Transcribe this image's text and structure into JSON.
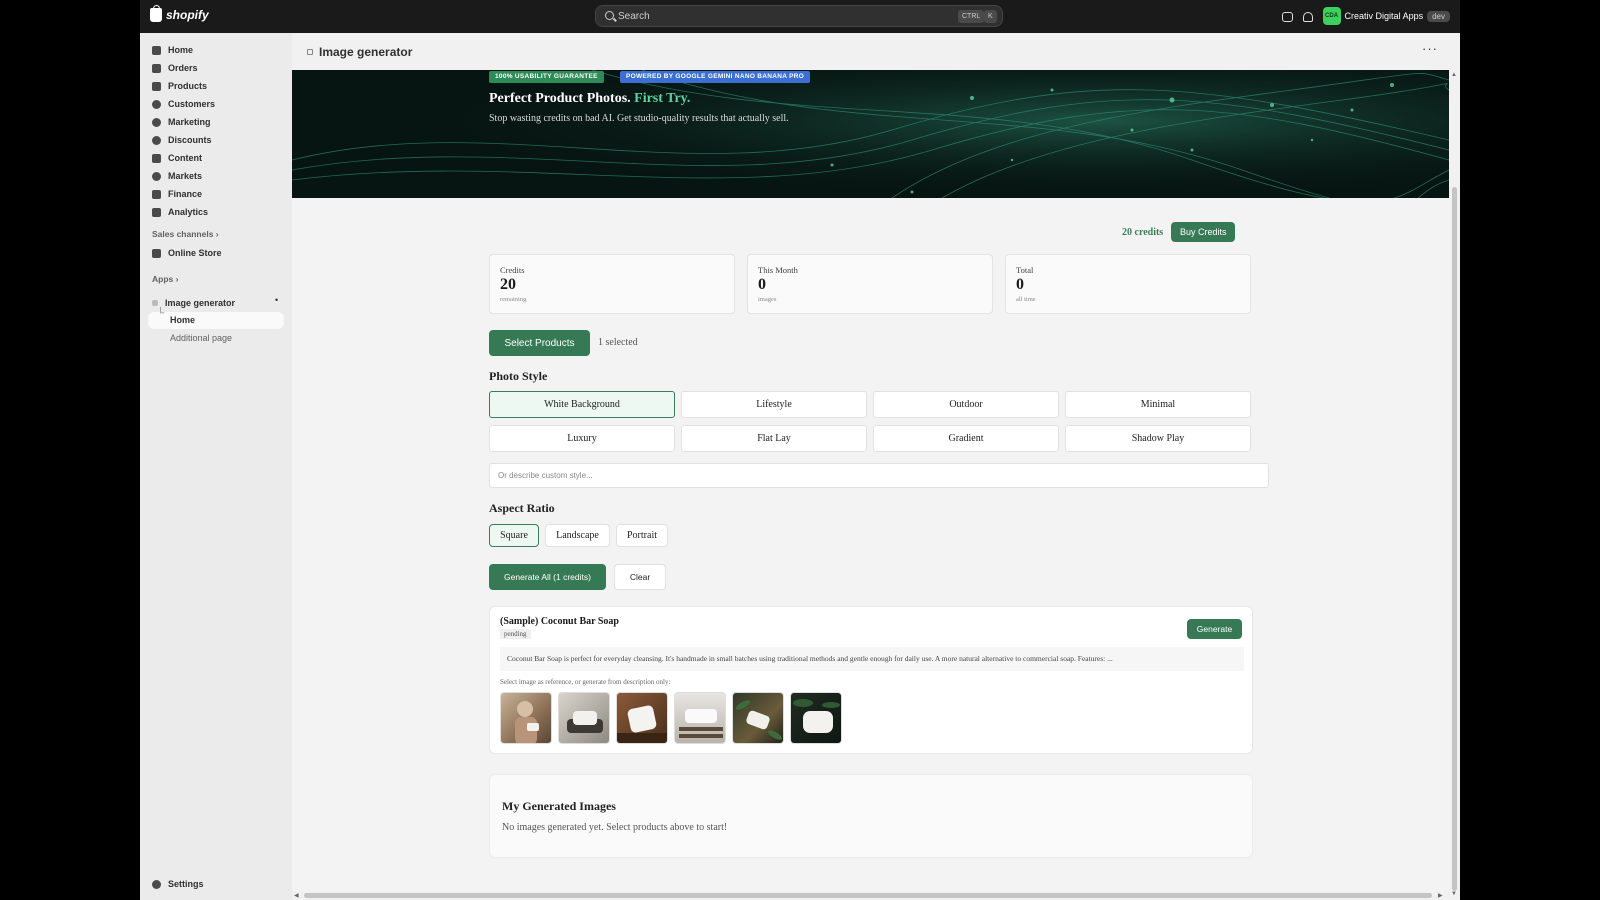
{
  "topbar": {
    "logo_text": "shopify",
    "search_placeholder": "Search",
    "shortcut_keys": [
      "CTRL",
      "K"
    ],
    "avatar_initials": "CDA",
    "store_name": "Creativ Digital Apps",
    "env_badge": "dev"
  },
  "sidebar": {
    "items": [
      {
        "label": "Home",
        "icon": "home-icon"
      },
      {
        "label": "Orders",
        "icon": "orders-icon"
      },
      {
        "label": "Products",
        "icon": "tag-icon"
      },
      {
        "label": "Customers",
        "icon": "person-icon"
      },
      {
        "label": "Marketing",
        "icon": "target-icon"
      },
      {
        "label": "Discounts",
        "icon": "discount-icon"
      },
      {
        "label": "Content",
        "icon": "content-icon"
      },
      {
        "label": "Markets",
        "icon": "globe-icon"
      },
      {
        "label": "Finance",
        "icon": "bank-icon"
      },
      {
        "label": "Analytics",
        "icon": "bar-chart-icon"
      }
    ],
    "sales_channels_label": "Sales channels",
    "online_store": "Online Store",
    "apps_label": "Apps",
    "app_name": "Image generator",
    "app_home": "Home",
    "app_additional": "Additional page",
    "settings": "Settings"
  },
  "page": {
    "title": "Image generator",
    "more": "···"
  },
  "hero": {
    "badge1": "100% USABILITY GUARANTEE",
    "badge2": "POWERED BY GOOGLE GEMINI NANO BANANA PRO",
    "title_main": "Perfect Product Photos.",
    "title_highlight": "First Try.",
    "subtitle": "Stop wasting credits on bad AI. Get studio-quality results that actually sell."
  },
  "credits": {
    "label": "20 credits",
    "buy_button": "Buy Credits"
  },
  "stats": [
    {
      "label": "Credits",
      "value": "20",
      "sub": "remaining"
    },
    {
      "label": "This Month",
      "value": "0",
      "sub": "images"
    },
    {
      "label": "Total",
      "value": "0",
      "sub": "all time"
    }
  ],
  "selection": {
    "button": "Select Products",
    "count_text": "1 selected"
  },
  "photo_style": {
    "heading": "Photo Style",
    "options": [
      "White Background",
      "Lifestyle",
      "Outdoor",
      "Minimal",
      "Luxury",
      "Flat Lay",
      "Gradient",
      "Shadow Play"
    ],
    "selected": "White Background",
    "custom_placeholder": "Or describe custom style..."
  },
  "aspect_ratio": {
    "heading": "Aspect Ratio",
    "options": [
      "Square",
      "Landscape",
      "Portrait"
    ],
    "selected": "Square"
  },
  "actions": {
    "generate_all": "Generate All (1 credits)",
    "clear": "Clear"
  },
  "product": {
    "name": "(Sample) Coconut Bar Soap",
    "status": "pending",
    "generate_button": "Generate",
    "description": "Coconut Bar Soap is perfect for everyday cleansing. It's handmade in small batches using traditional methods and gentle enough for daily use. A more natural alternative to commercial soap. Features: ...",
    "reference_label": "Select image as reference, or generate from description only:"
  },
  "gallery": {
    "title": "My Generated Images",
    "empty": "No images generated yet. Select products above to start!"
  },
  "colors": {
    "brand_green": "#367a55",
    "highlight_green": "#5dd39e",
    "badge_green": "#2e8b57",
    "badge_blue": "#3b6fd1"
  }
}
